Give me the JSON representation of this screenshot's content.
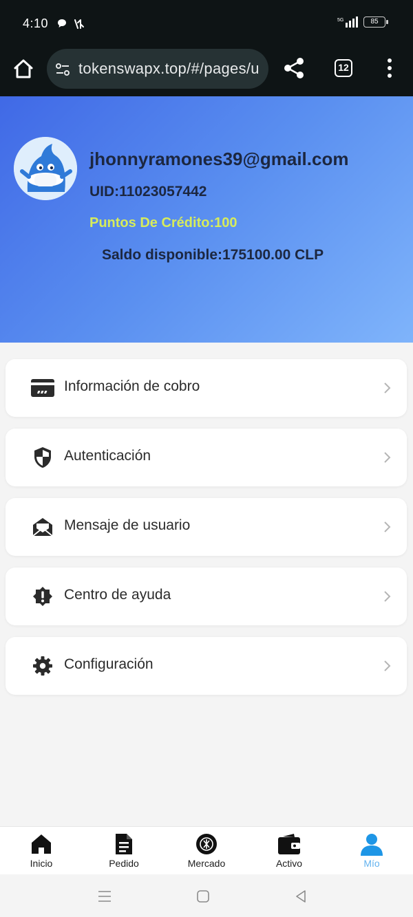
{
  "status_bar": {
    "time": "4:10",
    "network": "5G",
    "battery": "85"
  },
  "browser": {
    "url": "tokenswapx.top/#/pages/u",
    "tab_count": "12",
    "icons": [
      "home-icon",
      "tune-icon",
      "share-icon",
      "tabs-icon",
      "more-vert-icon"
    ]
  },
  "profile": {
    "email": "jhonnyramones39@gmail.com",
    "uid": "UID:11023057442",
    "credit": "Puntos De Crédito:100",
    "balance": "Saldo disponible:175100.00 CLP",
    "credit_color": "#d7ec5b"
  },
  "menu": {
    "items": [
      {
        "label": "Información de cobro",
        "icon": "credit-card-icon"
      },
      {
        "label": "Autenticación",
        "icon": "shield-icon"
      },
      {
        "label": "Mensaje de usuario",
        "icon": "mail-open-icon"
      },
      {
        "label": "Centro de ayuda",
        "icon": "alert-badge-icon"
      },
      {
        "label": "Configuración",
        "icon": "gear-icon"
      }
    ]
  },
  "bottom_nav": {
    "items": [
      {
        "label": "Inicio",
        "icon": "home-icon"
      },
      {
        "label": "Pedido",
        "icon": "document-icon"
      },
      {
        "label": "Mercado",
        "icon": "market-icon"
      },
      {
        "label": "Activo",
        "icon": "wallet-icon"
      },
      {
        "label": "Mío",
        "icon": "user-icon"
      }
    ],
    "active": "Mío",
    "active_color": "#62b2ef"
  }
}
